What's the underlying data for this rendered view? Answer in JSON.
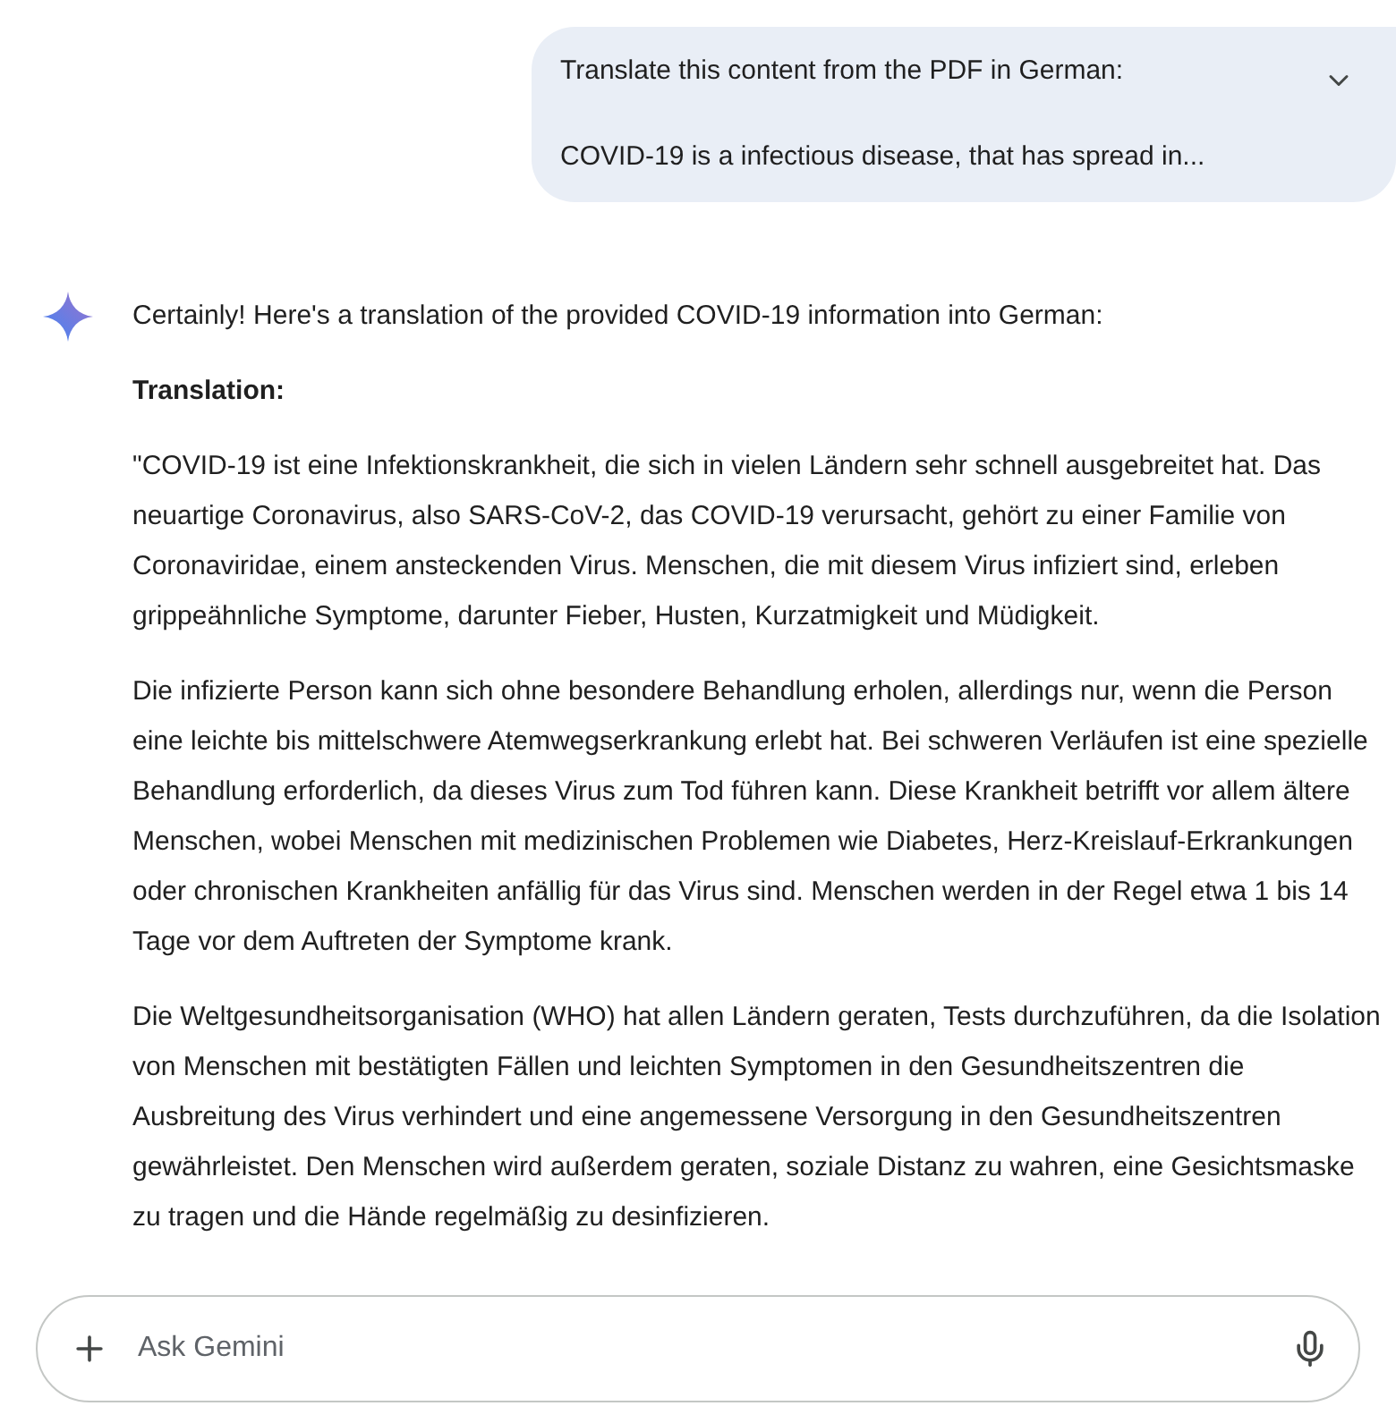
{
  "user_message": {
    "expanded": false,
    "lines": [
      "Translate this content from the PDF in German:",
      "COVID-19 is a infectious disease, that has spread in..."
    ]
  },
  "response": {
    "intro": "Certainly! Here's a translation of the provided COVID-19 information into German:",
    "heading": "Translation:",
    "paragraphs": [
      "\"COVID-19 ist eine Infektionskrankheit, die sich in vielen Ländern sehr schnell ausgebreitet hat. Das neuartige Coronavirus, also SARS-CoV-2, das COVID-19 verursacht, gehört zu einer Familie von Coronaviridae, einem ansteckenden Virus. Menschen, die mit diesem Virus infiziert sind, erleben grippeähnliche Symptome, darunter Fieber, Husten, Kurzatmigkeit und Müdigkeit.",
      "Die infizierte Person kann sich ohne besondere Behandlung erholen, allerdings nur, wenn die Person eine leichte bis mittelschwere Atemwegserkrankung erlebt hat. Bei schweren Verläufen ist eine spezielle Behandlung erforderlich, da dieses Virus zum Tod führen kann. Diese Krankheit betrifft vor allem ältere Menschen, wobei Menschen mit medizinischen Problemen wie Diabetes, Herz-Kreislauf-Erkrankungen oder chronischen Krankheiten anfällig für das Virus sind. Menschen werden in der Regel etwa 1 bis 14 Tage vor dem Auftreten der Symptome krank.",
      "Die Weltgesundheitsorganisation (WHO) hat allen Ländern geraten, Tests durchzuführen, da die Isolation von Menschen mit bestätigten Fällen und leichten Symptomen in den Gesundheitszentren die Ausbreitung des Virus verhindert und eine angemessene Versorgung in den Gesundheitszentren gewährleistet. Den Menschen wird außerdem geraten, soziale Distanz zu wahren, eine Gesichtsmaske zu tragen und die Hände regelmäßig zu desinfizieren."
    ]
  },
  "input": {
    "placeholder": "Ask Gemini"
  }
}
